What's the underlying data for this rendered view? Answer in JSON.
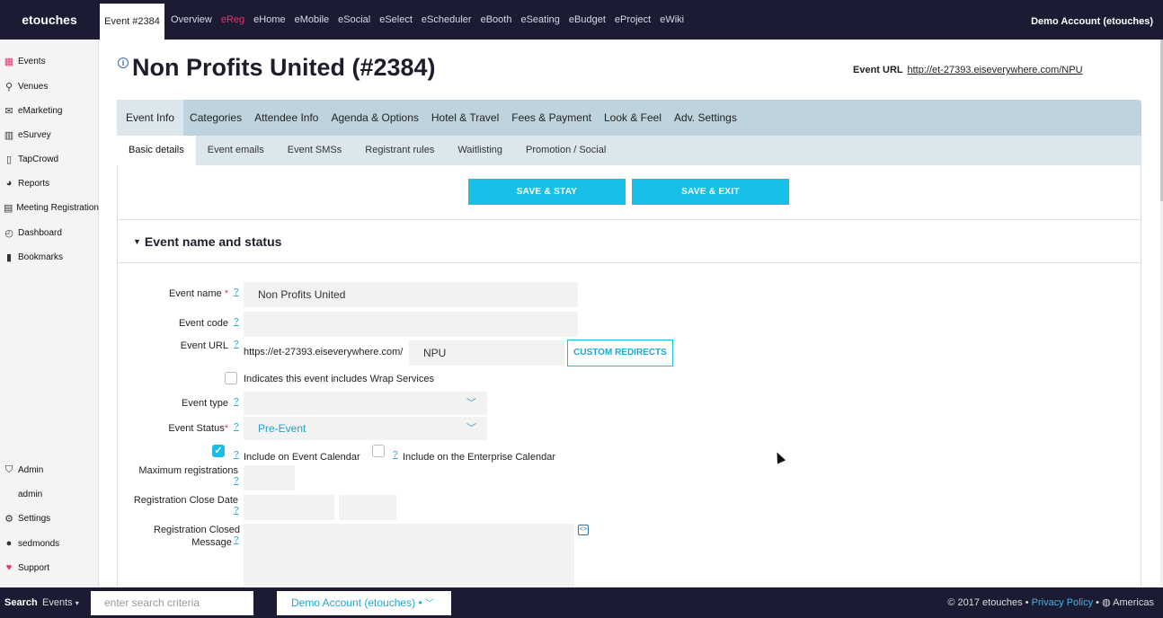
{
  "topbar": {
    "brand": "etouches",
    "event_tab": "Event #2384",
    "nav": [
      "Overview",
      "eReg",
      "eHome",
      "eMobile",
      "eSocial",
      "eSelect",
      "eScheduler",
      "eBooth",
      "eSeating",
      "eBudget",
      "eProject",
      "eWiki"
    ],
    "active_nav": "eReg",
    "account": "Demo Account (etouches)"
  },
  "sidebar": {
    "items": [
      {
        "label": "Events",
        "icon": "calendar-icon"
      },
      {
        "label": "Venues",
        "icon": "map-pin-icon"
      },
      {
        "label": "eMarketing",
        "icon": "envelope-icon"
      },
      {
        "label": "eSurvey",
        "icon": "chart-icon"
      },
      {
        "label": "TapCrowd",
        "icon": "mobile-icon"
      },
      {
        "label": "Reports",
        "icon": "pie-chart-icon"
      },
      {
        "label": "Meeting Registration",
        "icon": "meeting-icon"
      },
      {
        "label": "Dashboard",
        "icon": "gauge-icon"
      },
      {
        "label": "Bookmarks",
        "icon": "bookmark-icon"
      }
    ],
    "bottom_items": [
      {
        "label": "Admin",
        "icon": "shield-icon"
      },
      {
        "label": "admin",
        "icon": ""
      },
      {
        "label": "Settings",
        "icon": "gear-icon"
      },
      {
        "label": "sedmonds",
        "icon": "user-icon"
      },
      {
        "label": "Support",
        "icon": "heart-icon"
      }
    ]
  },
  "header": {
    "title": "Non Profits United (#2384)",
    "event_url_label": "Event URL",
    "event_url": "http://et-27393.eiseverywhere.com/NPU"
  },
  "tabs_primary": [
    "Event Info",
    "Categories",
    "Attendee Info",
    "Agenda & Options",
    "Hotel & Travel",
    "Fees & Payment",
    "Look & Feel",
    "Adv. Settings"
  ],
  "tabs_secondary": [
    "Basic details",
    "Event emails",
    "Event SMSs",
    "Registrant rules",
    "Waitlisting",
    "Promotion / Social"
  ],
  "actions": {
    "save_stay": "SAVE & STAY",
    "save_exit": "SAVE & EXIT"
  },
  "section": {
    "title": "Event name and status"
  },
  "form": {
    "help": "?",
    "required_mark": "*",
    "event_name_label": "Event name",
    "event_name_value": "Non Profits United",
    "event_code_label": "Event code",
    "event_code_value": "",
    "event_url_label": "Event URL",
    "event_url_prefix": "https://et-27393.eiseverywhere.com/",
    "event_url_value": "NPU",
    "custom_redirects": "CUSTOM REDIRECTS",
    "wrap_services_label": "Indicates this event includes Wrap Services",
    "wrap_services_checked": false,
    "event_type_label": "Event type",
    "event_type_value": "",
    "event_status_label": "Event Status",
    "event_status_value": "Pre-Event",
    "include_event_calendar": "Include on Event Calendar",
    "include_event_calendar_checked": true,
    "include_enterprise_calendar": "Include on the Enterprise Calendar",
    "include_enterprise_calendar_checked": false,
    "max_reg_label": "Maximum registrations",
    "reg_close_date_label": "Registration Close Date",
    "reg_closed_msg_label_1": "Registration Closed",
    "reg_closed_msg_label_2": "Message"
  },
  "bottombar": {
    "search": "Search",
    "scope": "Events",
    "search_placeholder": "enter search criteria",
    "account_select": "Demo Account (etouches) •",
    "copyright": "© 2017 etouches •",
    "privacy": "Privacy Policy",
    "separator": "•",
    "region": "Americas"
  }
}
